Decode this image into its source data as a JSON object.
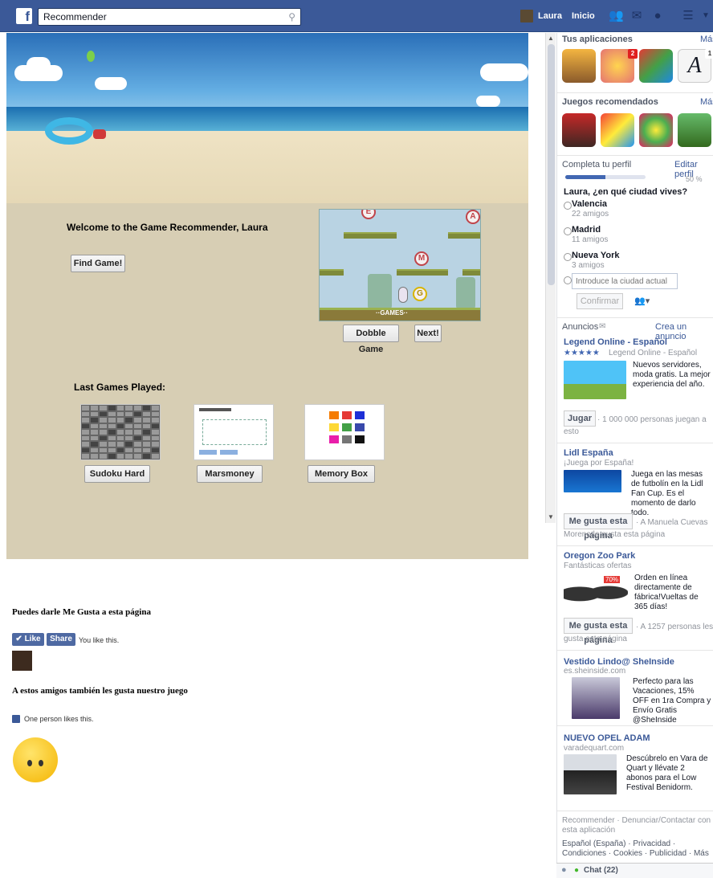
{
  "topbar": {
    "logo": "f",
    "search_value": "Recommender",
    "user_name": "Laura",
    "home_label": "Inicio"
  },
  "game": {
    "welcome": "Welcome to the Game Recommender, Laura",
    "find_button": "Find Game!",
    "preview_title": "Dobble Game",
    "next_button": "Next!",
    "preview_bottom": "··GAMES··",
    "last_title": "Last Games Played:",
    "last_games": [
      "Sudoku Hard",
      "Marsmoney",
      "Memory Box"
    ],
    "memory_colors": [
      "#f57c00",
      "#e53935",
      "#1e2fd6",
      "#fdd835",
      "#43a047",
      "#3949ab",
      "#e91eaa",
      "#757575",
      "#111111"
    ]
  },
  "below": {
    "like_prompt": "Puedes darle Me Gusta a esta página",
    "like_label": "✔ Like",
    "share_label": "Share",
    "you_like": "You like this.",
    "friends_title": "A estos amigos también les gusta nuestro juego",
    "one_person": "One person likes this."
  },
  "sidebar": {
    "apps_title": "Tus aplicaciones",
    "more": "Más",
    "apps_badges": [
      "2",
      "1"
    ],
    "recommended_title": "Juegos recomendados",
    "recommended_more": "Más",
    "profile_title": "Completa tu perfil",
    "profile_edit": "Editar perfil",
    "profile_progress": 50,
    "profile_percent": "50 %",
    "city_question": "Laura, ¿en qué ciudad vives?",
    "cities": [
      {
        "name": "Valencia",
        "friends": "22 amigos"
      },
      {
        "name": "Madrid",
        "friends": "11 amigos"
      },
      {
        "name": "Nueva York",
        "friends": "3 amigos"
      }
    ],
    "city_placeholder": "Introduce la ciudad actual",
    "confirm": "Confirmar",
    "ads_title": "Anuncios",
    "create_ad": "Crea un anuncio",
    "ads": [
      {
        "title": "Legend Online - Español",
        "sub": "Legend Online - Español",
        "text": "Nuevos servidores, moda gratis. La mejor experiencia del año.",
        "button": "Jugar",
        "social": "· 1 000 000 personas juegan a esto"
      },
      {
        "title": "Lidl España",
        "sub": "¡Juega por España!",
        "text": "Juega en las mesas de futbolín en la Lidl Fan Cup. Es el momento de darlo todo.",
        "button": "Me gusta esta página",
        "social": "· A Manuela Cuevas Moreno le gusta esta página"
      },
      {
        "title": "Oregon Zoo Park",
        "sub": "Fantásticas ofertas",
        "text": "Orden en línea directamente de fábrica!Vueltas de 365 días!",
        "button": "Me gusta esta página",
        "social": "· A 1257 personas les gusta esta página"
      },
      {
        "title": "Vestido Lindo@ SheInside",
        "sub": "es.sheinside.com",
        "text": "Perfecto para las Vacaciones, 15% OFF en 1ra Compra y Envío Gratis @SheInside"
      },
      {
        "title": "NUEVO OPEL ADAM",
        "sub": "varadequart.com",
        "text": "Descúbrelo en Vara de Quart y llévate 2 abonos para el Low Festival Benidorm."
      }
    ],
    "footer_line1": "Recommender · Denunciar/Contactar con esta aplicación",
    "footer_line2": "Español (España) · Privacidad · Condiciones · Cookies · Publicidad · Más",
    "chat": "Chat (22)",
    "sunglasses_badge": "70%"
  }
}
